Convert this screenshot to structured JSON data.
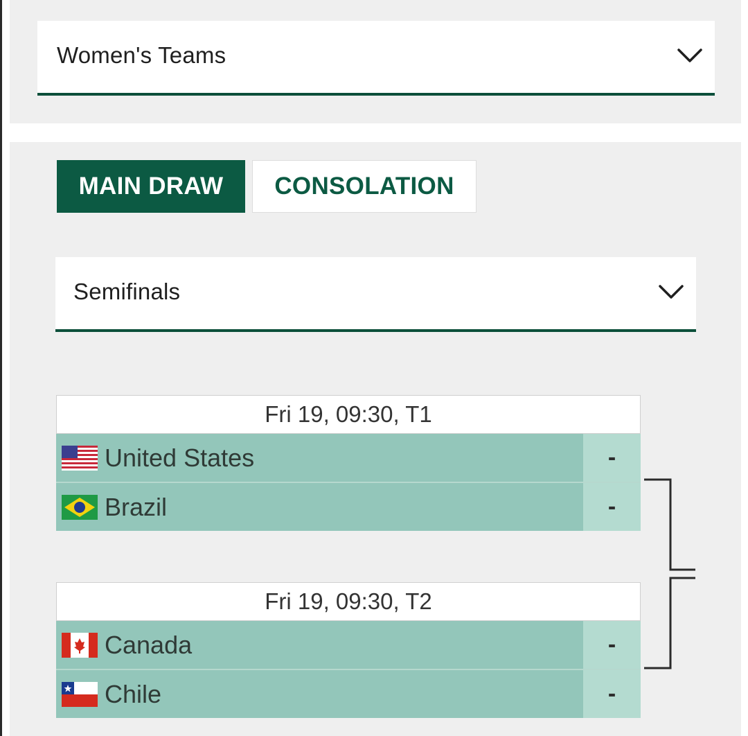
{
  "category_dropdown": {
    "value": "Women's Teams",
    "chevron_icon": "chevron-down-icon"
  },
  "tabs": [
    {
      "label": "MAIN DRAW",
      "active": true
    },
    {
      "label": "CONSOLATION",
      "active": false
    }
  ],
  "round_dropdown": {
    "value": "Semifinals",
    "chevron_icon": "chevron-down-icon"
  },
  "matches": [
    {
      "header": "Fri 19, 09:30, T1",
      "teams": [
        {
          "name": "United States",
          "flag": "us-flag-icon",
          "score": "-"
        },
        {
          "name": "Brazil",
          "flag": "brazil-flag-icon",
          "score": "-"
        }
      ]
    },
    {
      "header": "Fri 19, 09:30, T2",
      "teams": [
        {
          "name": "Canada",
          "flag": "canada-flag-icon",
          "score": "-"
        },
        {
          "name": "Chile",
          "flag": "chile-flag-icon",
          "score": "-"
        }
      ]
    }
  ],
  "colors": {
    "brand_green": "#0c5a43",
    "team_row_bg": "#93c6ba",
    "score_cell_bg": "#b4dbd0",
    "panel_bg": "#efefef"
  }
}
